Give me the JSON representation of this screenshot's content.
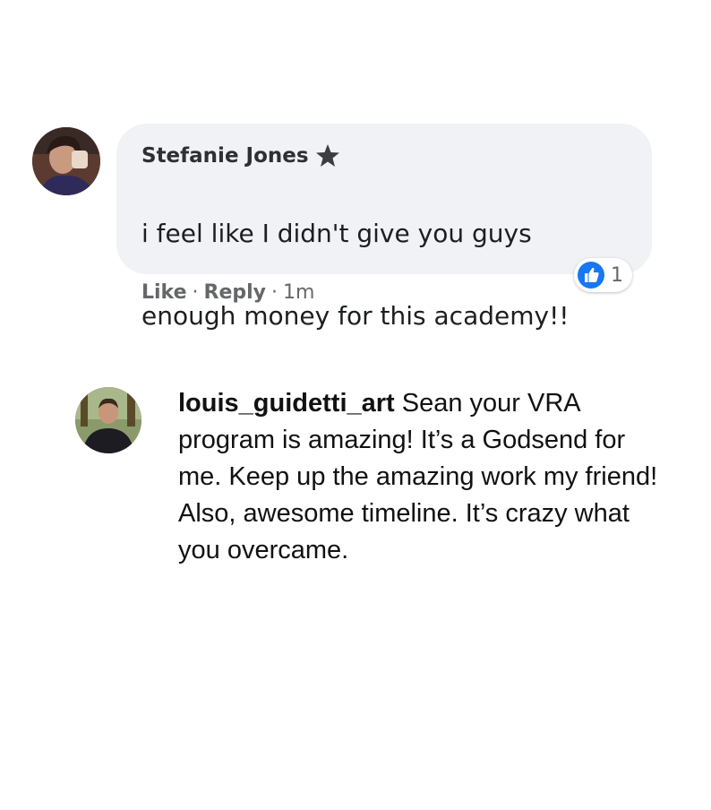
{
  "facebook_comment": {
    "author": "Stefanie Jones",
    "badge_icon": "top-fan-star-icon",
    "text_lines": [
      "i feel like I didn't give you guys",
      "enough money for this academy!!"
    ],
    "reaction": {
      "icon": "like-icon",
      "count": "1",
      "color": "#1877f2"
    },
    "actions": {
      "like": "Like",
      "separator": "·",
      "reply": "Reply",
      "time": "1m"
    },
    "bubble_color": "#f0f2f5"
  },
  "instagram_comment": {
    "username": "louis_guidetti_art",
    "text": "Sean your VRA program is amazing! It’s a Godsend for me. Keep up the amazing work my friend! Also, awesome timeline. It’s crazy what you overcame."
  }
}
